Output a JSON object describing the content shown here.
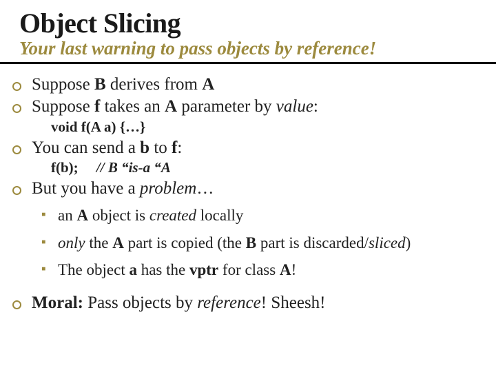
{
  "header": {
    "title": "Object Slicing",
    "subtitle": "Your last warning to pass objects by reference!"
  },
  "body": {
    "b1": {
      "t1": "Suppose ",
      "t2": "B",
      "t3": " derives from ",
      "t4": "A"
    },
    "b2": {
      "t1": "Suppose ",
      "t2": "f",
      "t3": " takes an ",
      "t4": "A",
      "t5": " parameter by ",
      "t6": "value",
      "t7": ":",
      "code": "void f(A a) {…}"
    },
    "b3": {
      "t1": "You can send a ",
      "t2": "b",
      "t3": " to ",
      "t4": "f",
      "t5": ":",
      "code1": "f(b);    ",
      "code2": "// B “is-a “A"
    },
    "b4": {
      "t1": "But you have a ",
      "t2": "problem",
      "t3": "…"
    },
    "s1": {
      "t1": "an ",
      "t2": "A",
      "t3": " object is ",
      "t4": "created",
      "t5": " locally"
    },
    "s2": {
      "t1": "only",
      "t2": " the ",
      "t3": "A",
      "t4": " part is copied (the ",
      "t5": "B",
      "t6": " part is discarded/",
      "t7": "sliced",
      "t8": ")"
    },
    "s3": {
      "t1": "The object ",
      "t2": "a",
      "t3": " has the ",
      "t4": "vptr",
      "t5": " for class ",
      "t6": "A",
      "t7": "!"
    },
    "b5": {
      "t1": "Moral:",
      "t2": " Pass objects by ",
      "t3": "reference",
      "t4": "! Sheesh!"
    }
  }
}
